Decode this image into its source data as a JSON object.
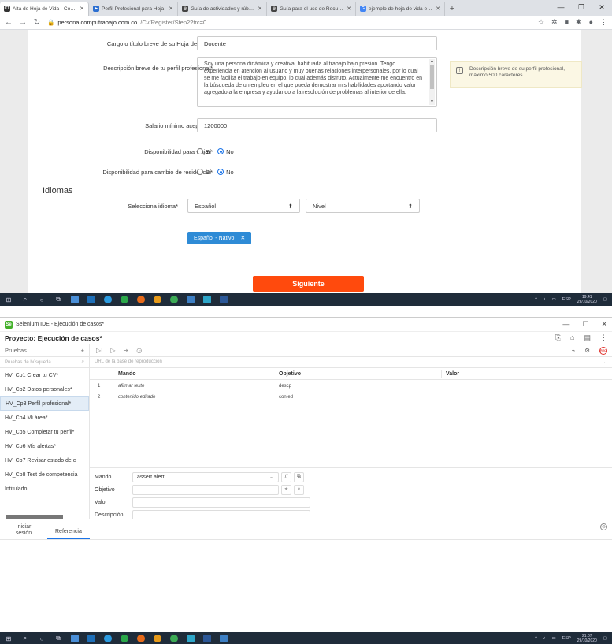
{
  "browser": {
    "tabs": [
      {
        "label": "Alta de Hoja de Vida - Compu",
        "fav": "CT",
        "color": "#333333"
      },
      {
        "label": "Perfil Profesional para Hoja",
        "fav": "▶",
        "color": "#2c6fd1"
      },
      {
        "label": "Guía de actividades y rúbrica",
        "fav": "◎",
        "color": "#444444"
      },
      {
        "label": "Guía para el uso de Recursos",
        "fav": "◎",
        "color": "#444444"
      },
      {
        "label": "ejemplo de hoja de vida en co",
        "fav": "G",
        "color": "#4285f4"
      }
    ],
    "url_host": "persona.computrabajo.com.co",
    "url_path": "/Cv/Register/Step2?trc=0"
  },
  "form": {
    "cargo_label": "Cargo o título breve de su Hoja de Vida*",
    "cargo_value": "Docente",
    "descripcion_label": "Descripción breve de tu perfil profesional*",
    "descripcion_value": "Soy una persona dinámica y creativa, habituada al trabajo bajo presión. Tengo experiencia en atención al usuario y muy buenas relaciones interpersonales, por lo cual se me facilita el trabajo en equipo, lo cual además disfruto. Actualmente me encuentro en la búsqueda de un empleo en el que pueda demostrar mis habilidades aportando valor agregado a la empresa y ayudando a la resolución de problemas al interior de ella.",
    "hint": "Descripción breve de su perfil profesional, máximo 500 caracteres",
    "salario_label": "Salario mínimo aceptado*",
    "salario_value": "1200000",
    "viajar_label": "Disponibilidad para viajar*",
    "residencia_label": "Disponibilidad para cambio de residencia*",
    "si": "Sí",
    "no": "No",
    "idiomas_title": "Idiomas",
    "idioma_label": "Selecciona idioma*",
    "idioma_value": "Español",
    "nivel_value": "Nivel",
    "chip": "Español - Nativo",
    "next_button": "Siguiente"
  },
  "taskbar1": {
    "time": "19:41",
    "date": "29/10/2020",
    "lang": "ESP"
  },
  "ide": {
    "window_title": "Selenium IDE - Ejecución de casos*",
    "project": "Proyecto: Ejecución de casos*",
    "tests_header": "Pruebas",
    "search_placeholder": "Pruebas de búsqueda",
    "url_placeholder": "URL de la base de reproducción",
    "tests": [
      "HV_Cp1 Crear tu CV*",
      "HV_Cp2 Datos personales*",
      "HV_Cp3 Perfil profesional*",
      "HV_Cp4 Mi área*",
      "HV_Cp5 Completar tu perfil*",
      "HV_Cp6 Mis alertas*",
      "HV_Cp7 Revisar estado de c",
      "HV_Cp8 Test de competencia",
      "Intitulado"
    ],
    "col_mando": "Mando",
    "col_objetivo": "Objetivo",
    "col_valor": "Valor",
    "rows": [
      {
        "n": "1",
        "mando": "afirmar texto",
        "objetivo": "descp"
      },
      {
        "n": "2",
        "mando": "contenido editado",
        "objetivo": "con ed"
      }
    ],
    "ed_mando_label": "Mando",
    "ed_mando_value": "assert alert",
    "ed_objetivo_label": "Objetivo",
    "ed_valor_label": "Valor",
    "ed_descripcion_label": "Descripción",
    "log_tab1": "Iniciar sesión",
    "log_tab2": "Referencia"
  },
  "taskbar2": {
    "time": "21:07",
    "date": "29/10/2020",
    "lang": "ESP"
  }
}
